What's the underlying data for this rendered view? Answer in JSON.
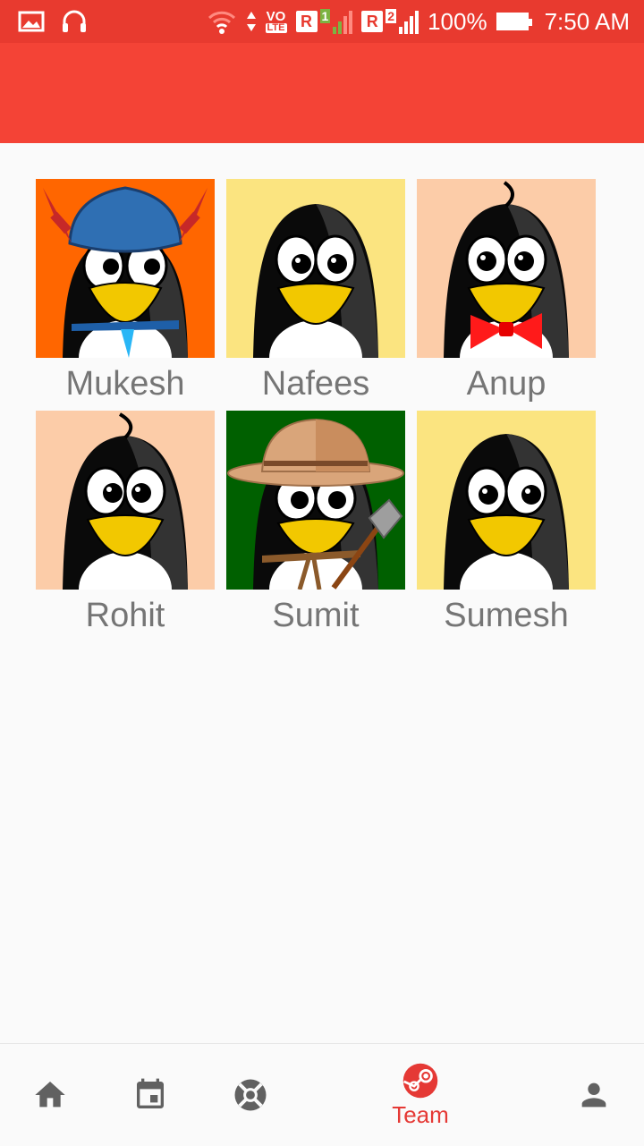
{
  "status_bar": {
    "vo_label": "VO",
    "lte_label": "LTE",
    "sim1_label": "R",
    "sim1_slot": "1",
    "sim2_label": "R",
    "sim2_slot": "2",
    "battery_percent": "100%",
    "time": "7:50 AM",
    "icons": [
      "gallery-icon",
      "headset-icon",
      "wifi-icon",
      "data-arrows-icon",
      "signal-icon",
      "battery-icon"
    ]
  },
  "colors": {
    "status_bar": "#e83a2f",
    "app_bar": "#f44336",
    "active_nav": "#e53935",
    "inactive_nav": "#616161",
    "member_name": "#757575"
  },
  "team": {
    "members": [
      {
        "name": "Mukesh",
        "avatar_bg": "#ff6600",
        "accessory": "viking-helmet-tie"
      },
      {
        "name": "Nafees",
        "avatar_bg": "#fbe480",
        "accessory": "none"
      },
      {
        "name": "Anup",
        "avatar_bg": "#fccca8",
        "accessory": "bow-tie"
      },
      {
        "name": "Rohit",
        "avatar_bg": "#fccca8",
        "accessory": "hair-tuft"
      },
      {
        "name": "Sumit",
        "avatar_bg": "#006000",
        "accessory": "safari-hat-shovel"
      },
      {
        "name": "Sumesh",
        "avatar_bg": "#fbe480",
        "accessory": "none"
      }
    ]
  },
  "bottom_nav": {
    "items": [
      {
        "icon": "home-icon",
        "label": ""
      },
      {
        "icon": "calendar-icon",
        "label": ""
      },
      {
        "icon": "lifebuoy-icon",
        "label": ""
      },
      {
        "icon": "steam-icon",
        "label": "Team",
        "active": true
      },
      {
        "icon": "person-icon",
        "label": ""
      }
    ]
  }
}
